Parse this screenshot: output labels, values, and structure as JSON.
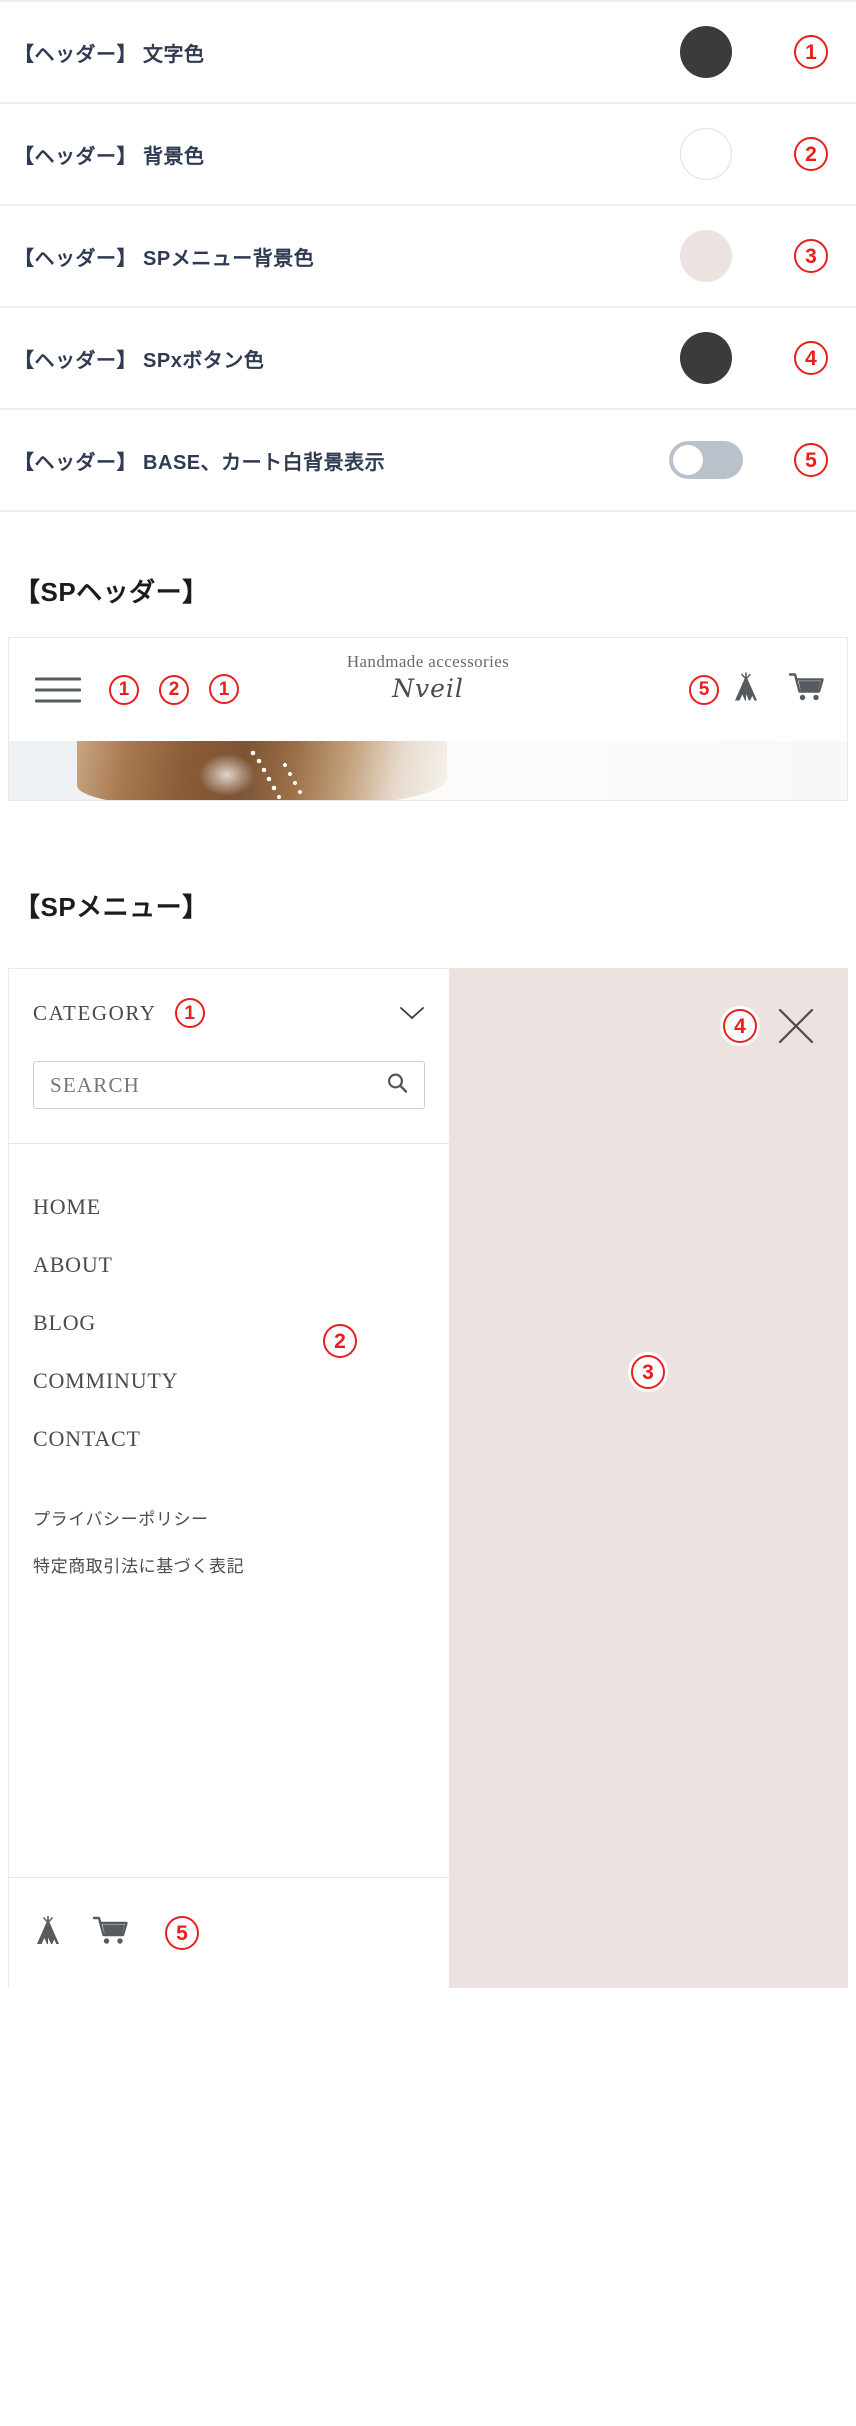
{
  "settings": {
    "rows": [
      {
        "label": "【ヘッダー】 文字色",
        "control": "color-swatch",
        "swatch_color": "#3b3b3b",
        "swatch_style": "dark",
        "badge": "1"
      },
      {
        "label": "【ヘッダー】 背景色",
        "control": "color-swatch",
        "swatch_color": "#ffffff",
        "swatch_style": "white",
        "badge": "2"
      },
      {
        "label": "【ヘッダー】 SPメニュー背景色",
        "control": "color-swatch",
        "swatch_color": "#ece3e1",
        "swatch_style": "pink",
        "badge": "3"
      },
      {
        "label": "【ヘッダー】 SPxボタン色",
        "control": "color-swatch",
        "swatch_color": "#3b3b3b",
        "swatch_style": "dark",
        "badge": "4"
      },
      {
        "label": "【ヘッダー】 BASE、カート白背景表示",
        "control": "toggle",
        "toggle_state": "off",
        "badge": "5"
      }
    ]
  },
  "sections": {
    "sp_header_title": "【SPヘッダー】",
    "sp_menu_title": "【SPメニュー】"
  },
  "sp_header": {
    "hamburger_icon": "hamburger-menu-icon",
    "badge_hamburger": "1",
    "badge_background": "2",
    "badge_logo": "1",
    "logo_tagline": "Handmade accessories",
    "logo_name": "Nveil",
    "badge_icons": "5",
    "base_icon": "base-teepee-icon",
    "cart_icon": "shopping-cart-icon"
  },
  "sp_menu": {
    "category_label": "CATEGORY",
    "badge_category": "1",
    "chevron_icon": "chevron-down-icon",
    "badge_close": "4",
    "close_icon": "close-x-icon",
    "badge_overlay": "3",
    "badge_nav": "2",
    "badge_footer": "5",
    "search": {
      "placeholder": "SEARCH",
      "value": "",
      "icon": "search-icon"
    },
    "nav_items": [
      "HOME",
      "ABOUT",
      "BLOG",
      "COMMINUTY",
      "CONTACT"
    ],
    "sub_links": [
      "プライバシーポリシー",
      "特定商取引法に基づく表記"
    ],
    "footer_icons": {
      "base_icon": "base-teepee-icon",
      "cart_icon": "shopping-cart-icon"
    }
  },
  "colors": {
    "badge_red": "#e8201b",
    "label_navy": "#2f3b52",
    "menu_overlay_pink": "#ece3e1",
    "dark_swatch": "#3b3b3b",
    "toggle_track": "#b9c1cb"
  }
}
